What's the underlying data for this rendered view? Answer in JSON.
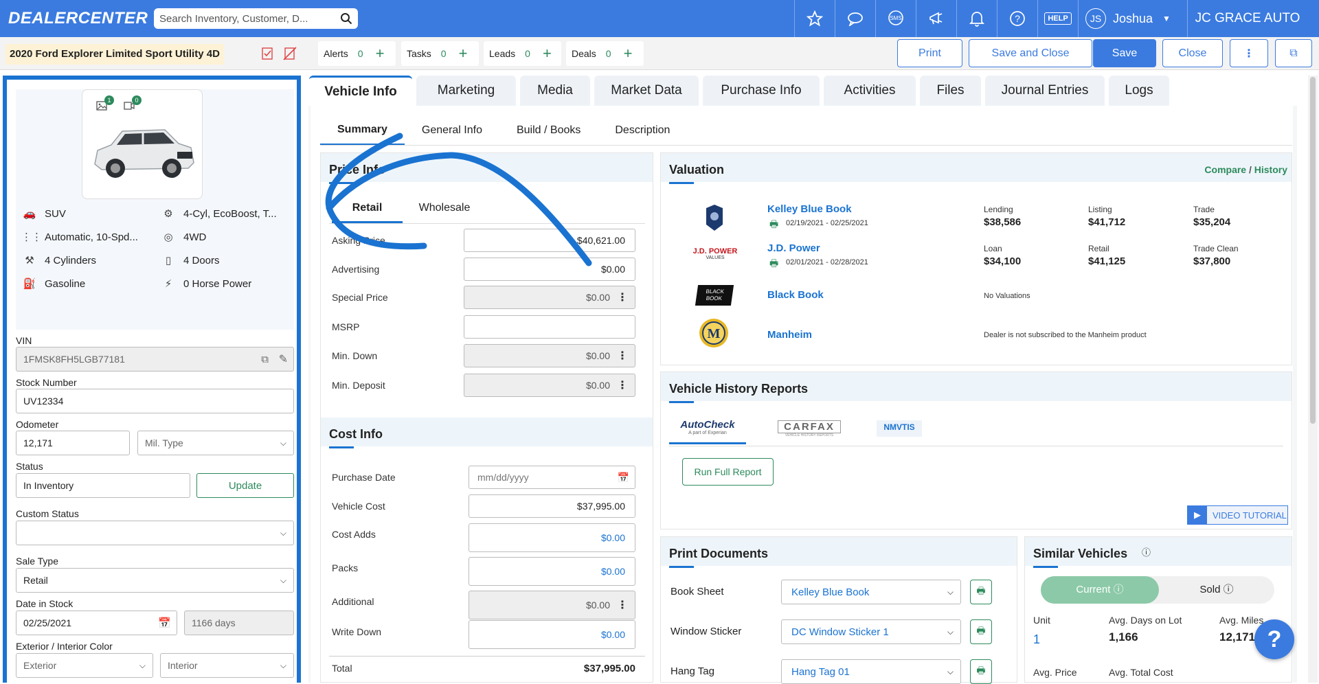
{
  "header": {
    "logo": "DEALERCENTER",
    "search_placeholder": "Search Inventory, Customer, D...",
    "help": "HELP",
    "user_initials": "JS",
    "user_name": "Joshua",
    "dealer": "JC GRACE AUTO"
  },
  "subheader": {
    "vehicle_title": "2020 Ford Explorer Limited Sport Utility 4D",
    "counters": [
      {
        "label": "Alerts",
        "value": "0"
      },
      {
        "label": "Tasks",
        "value": "0"
      },
      {
        "label": "Leads",
        "value": "0"
      },
      {
        "label": "Deals",
        "value": "0"
      }
    ],
    "buttons": {
      "print": "Print",
      "save_close": "Save and Close",
      "save": "Save",
      "close": "Close"
    }
  },
  "left": {
    "photo_count": "1",
    "video_count": "0",
    "specs": [
      {
        "icon": "car-body-icon",
        "text": "SUV"
      },
      {
        "icon": "engine-icon",
        "text": "4-Cyl, EcoBoost, T..."
      },
      {
        "icon": "transmission-icon",
        "text": "Automatic, 10-Spd..."
      },
      {
        "icon": "drivetrain-icon",
        "text": "4WD"
      },
      {
        "icon": "piston-icon",
        "text": "4 Cylinders"
      },
      {
        "icon": "door-icon",
        "text": "4 Doors"
      },
      {
        "icon": "fuel-icon",
        "text": "Gasoline"
      },
      {
        "icon": "horsepower-icon",
        "text": "0 Horse Power"
      }
    ],
    "vin_label": "VIN",
    "vin": "1FMSK8FH5LGB77181",
    "stock_label": "Stock Number",
    "stock": "UV12334",
    "odometer_label": "Odometer",
    "odometer": "12,171",
    "mil_type": "Mil. Type",
    "status_label": "Status",
    "status": "In Inventory",
    "update": "Update",
    "custom_status_label": "Custom Status",
    "sale_type_label": "Sale Type",
    "sale_type": "Retail",
    "date_stock_label": "Date in Stock",
    "date_stock": "02/25/2021",
    "days": "1166 days",
    "color_label": "Exterior / Interior Color",
    "exterior": "Exterior",
    "interior": "Interior"
  },
  "tabs": [
    "Vehicle Info",
    "Marketing",
    "Media",
    "Market Data",
    "Purchase Info",
    "Activities",
    "Files",
    "Journal Entries",
    "Logs"
  ],
  "subtabs": [
    "Summary",
    "General Info",
    "Build / Books",
    "Description"
  ],
  "price_info": {
    "title": "Price Info",
    "tab_retail": "Retail",
    "tab_wholesale": "Wholesale",
    "rows": [
      {
        "label": "Asking Price",
        "value": "$40,621.00"
      },
      {
        "label": "Advertising",
        "value": "$0.00"
      },
      {
        "label": "Special Price",
        "value": "$0.00"
      },
      {
        "label": "MSRP",
        "value": ""
      },
      {
        "label": "Min. Down",
        "value": "$0.00"
      },
      {
        "label": "Min. Deposit",
        "value": "$0.00"
      }
    ]
  },
  "cost_info": {
    "title": "Cost Info",
    "rows": [
      {
        "label": "Purchase Date",
        "value": "mm/dd/yyyy"
      },
      {
        "label": "Vehicle Cost",
        "value": "$37,995.00"
      },
      {
        "label": "Cost Adds",
        "value": "$0.00"
      },
      {
        "label": "Packs",
        "value": "$0.00"
      },
      {
        "label": "Additional",
        "value": "$0.00"
      },
      {
        "label": "Write Down",
        "value": "$0.00"
      }
    ],
    "total_label": "Total",
    "total": "$37,995.00"
  },
  "valuation": {
    "title": "Valuation",
    "compare": "Compare",
    "sep": "/",
    "history": "History",
    "kbb": {
      "name": "Kelley Blue Book",
      "date": "02/19/2021 - 02/25/2021",
      "l1": "Lending",
      "v1": "$38,586",
      "l2": "Listing",
      "v2": "$41,712",
      "l3": "Trade",
      "v3": "$35,204"
    },
    "jdp": {
      "logo": "J.D. POWER",
      "logo_sub": "VALUES",
      "name": "J.D. Power",
      "date": "02/01/2021 - 02/28/2021",
      "l1": "Loan",
      "v1": "$34,100",
      "l2": "Retail",
      "v2": "$41,125",
      "l3": "Trade Clean",
      "v3": "$37,800"
    },
    "bb": {
      "logo1": "BLACK",
      "logo2": "BOOK",
      "name": "Black Book",
      "note": "No Valuations"
    },
    "manheim": {
      "name": "Manheim",
      "note": "Dealer is not subscribed to the Manheim product"
    }
  },
  "history": {
    "title": "Vehicle History Reports",
    "autocheck": "AutoCheck",
    "autocheck_sub": "A part of Experian",
    "carfax": "CARFAX",
    "carfax_sub": "VEHICLE HISTORY REPORTS",
    "nmvtis": "NMVTIS",
    "run": "Run Full Report",
    "video": "VIDEO TUTORIAL"
  },
  "print_docs": {
    "title": "Print Documents",
    "rows": [
      {
        "label": "Book Sheet",
        "value": "Kelley Blue Book"
      },
      {
        "label": "Window Sticker",
        "value": "DC Window Sticker 1"
      },
      {
        "label": "Hang Tag",
        "value": "Hang Tag 01"
      }
    ]
  },
  "similar": {
    "title": "Similar Vehicles",
    "current": "Current",
    "sold": "Sold",
    "unit_label": "Unit",
    "unit": "1",
    "days_label": "Avg. Days on Lot",
    "days": "1,166",
    "miles_label": "Avg. Miles",
    "miles": "12,171",
    "price_label": "Avg. Price",
    "cost_label": "Avg. Total Cost"
  },
  "colors": {
    "brand": "#3b7be0",
    "accent_green": "#2c8a5c",
    "panel_border": "#1a73d1"
  }
}
